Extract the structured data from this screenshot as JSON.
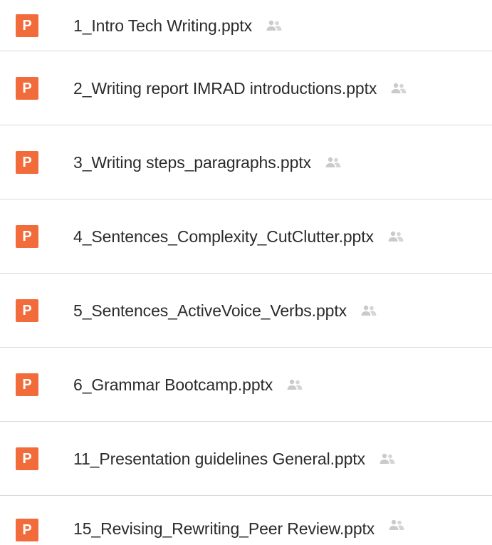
{
  "colors": {
    "ppt_accent": "#f26b3a",
    "shared_icon": "#b9b9b9"
  },
  "files": [
    {
      "icon_letter": "P",
      "name": "1_Intro Tech Writing.pptx",
      "file_icon": "powerpoint-file-icon",
      "status_icon": "shared-people-icon"
    },
    {
      "icon_letter": "P",
      "name": "2_Writing report IMRAD introductions.pptx",
      "file_icon": "powerpoint-file-icon",
      "status_icon": "shared-people-icon"
    },
    {
      "icon_letter": "P",
      "name": "3_Writing steps_paragraphs.pptx",
      "file_icon": "powerpoint-file-icon",
      "status_icon": "shared-people-icon"
    },
    {
      "icon_letter": "P",
      "name": "4_Sentences_Complexity_CutClutter.pptx",
      "file_icon": "powerpoint-file-icon",
      "status_icon": "shared-people-icon"
    },
    {
      "icon_letter": "P",
      "name": "5_Sentences_ActiveVoice_Verbs.pptx",
      "file_icon": "powerpoint-file-icon",
      "status_icon": "shared-people-icon"
    },
    {
      "icon_letter": "P",
      "name": "6_Grammar Bootcamp.pptx",
      "file_icon": "powerpoint-file-icon",
      "status_icon": "shared-people-icon"
    },
    {
      "icon_letter": "P",
      "name": "11_Presentation guidelines General.pptx",
      "file_icon": "powerpoint-file-icon",
      "status_icon": "shared-people-icon"
    },
    {
      "icon_letter": "P",
      "name": "15_Revising_Rewriting_Peer Review.pptx",
      "file_icon": "powerpoint-file-icon",
      "status_icon": "shared-people-icon"
    }
  ]
}
